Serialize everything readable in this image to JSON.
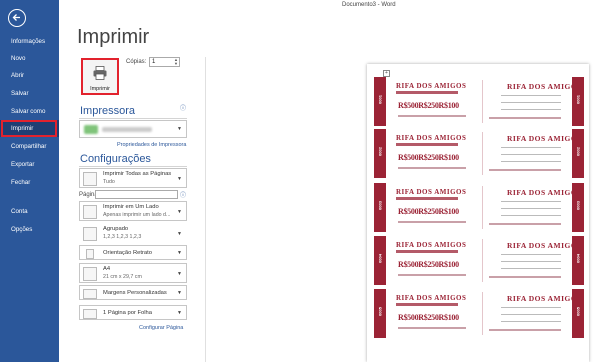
{
  "window": {
    "title": "Documento3 - Word"
  },
  "sidebar": {
    "items": [
      {
        "label": "Informações"
      },
      {
        "label": "Novo"
      },
      {
        "label": "Abrir"
      },
      {
        "label": "Salvar"
      },
      {
        "label": "Salvar como"
      },
      {
        "label": "Imprimir"
      },
      {
        "label": "Compartilhar"
      },
      {
        "label": "Exportar"
      },
      {
        "label": "Fechar"
      },
      {
        "label": "Conta"
      },
      {
        "label": "Opções"
      }
    ],
    "active": "Imprimir"
  },
  "page": {
    "title": "Imprimir"
  },
  "print": {
    "button_label": "Imprimir",
    "copies_label": "Cópias:",
    "copies_value": "1"
  },
  "printer": {
    "section_title": "Impressora",
    "properties_link": "Propriedades de Impressora"
  },
  "settings": {
    "section_title": "Configurações",
    "pages_label": "Páginas:",
    "options": [
      {
        "title": "Imprimir Todas as Páginas",
        "subtitle": "Tudo"
      },
      {
        "title": "Imprimir em Um Lado",
        "subtitle": "Apenas imprimir um lado d..."
      },
      {
        "title": "Agrupado",
        "subtitle": "1,2,3   1,2,3   1,2,3"
      },
      {
        "title": "Orientação Retrato",
        "subtitle": ""
      },
      {
        "title": "A4",
        "subtitle": "21 cm x 29,7 cm"
      },
      {
        "title": "Margens Personalizadas",
        "subtitle": ""
      },
      {
        "title": "1 Página por Folha",
        "subtitle": ""
      }
    ],
    "page_setup_link": "Configurar Página"
  },
  "preview": {
    "tickets": [
      {
        "number": "0001",
        "left_title": "RIFA DOS AMIGOS",
        "right_title": "RIFA DOS AMIGOS",
        "prizes": "R$500R$250R$100"
      },
      {
        "number": "0002",
        "left_title": "RIFA DOS AMIGOS",
        "right_title": "RIFA DOS AMIGOS",
        "prizes": "R$500R$250R$100"
      },
      {
        "number": "0003",
        "left_title": "RIFA DOS AMIGOS",
        "right_title": "RIFA DOS AMIGOS",
        "prizes": "R$500R$250R$100"
      },
      {
        "number": "0004",
        "left_title": "RIFA DOS AMIGOS",
        "right_title": "RIFA DOS AMIGOS",
        "prizes": "R$500R$250R$100"
      },
      {
        "number": "0005",
        "left_title": "RIFA DOS AMIGOS",
        "right_title": "RIFA DOS AMIGOS",
        "prizes": "R$500R$250R$100"
      }
    ]
  },
  "colors": {
    "sidebar": "#2b579a",
    "accent": "#2b579a",
    "highlight": "#e2222d",
    "ticket": "#9b2335"
  }
}
